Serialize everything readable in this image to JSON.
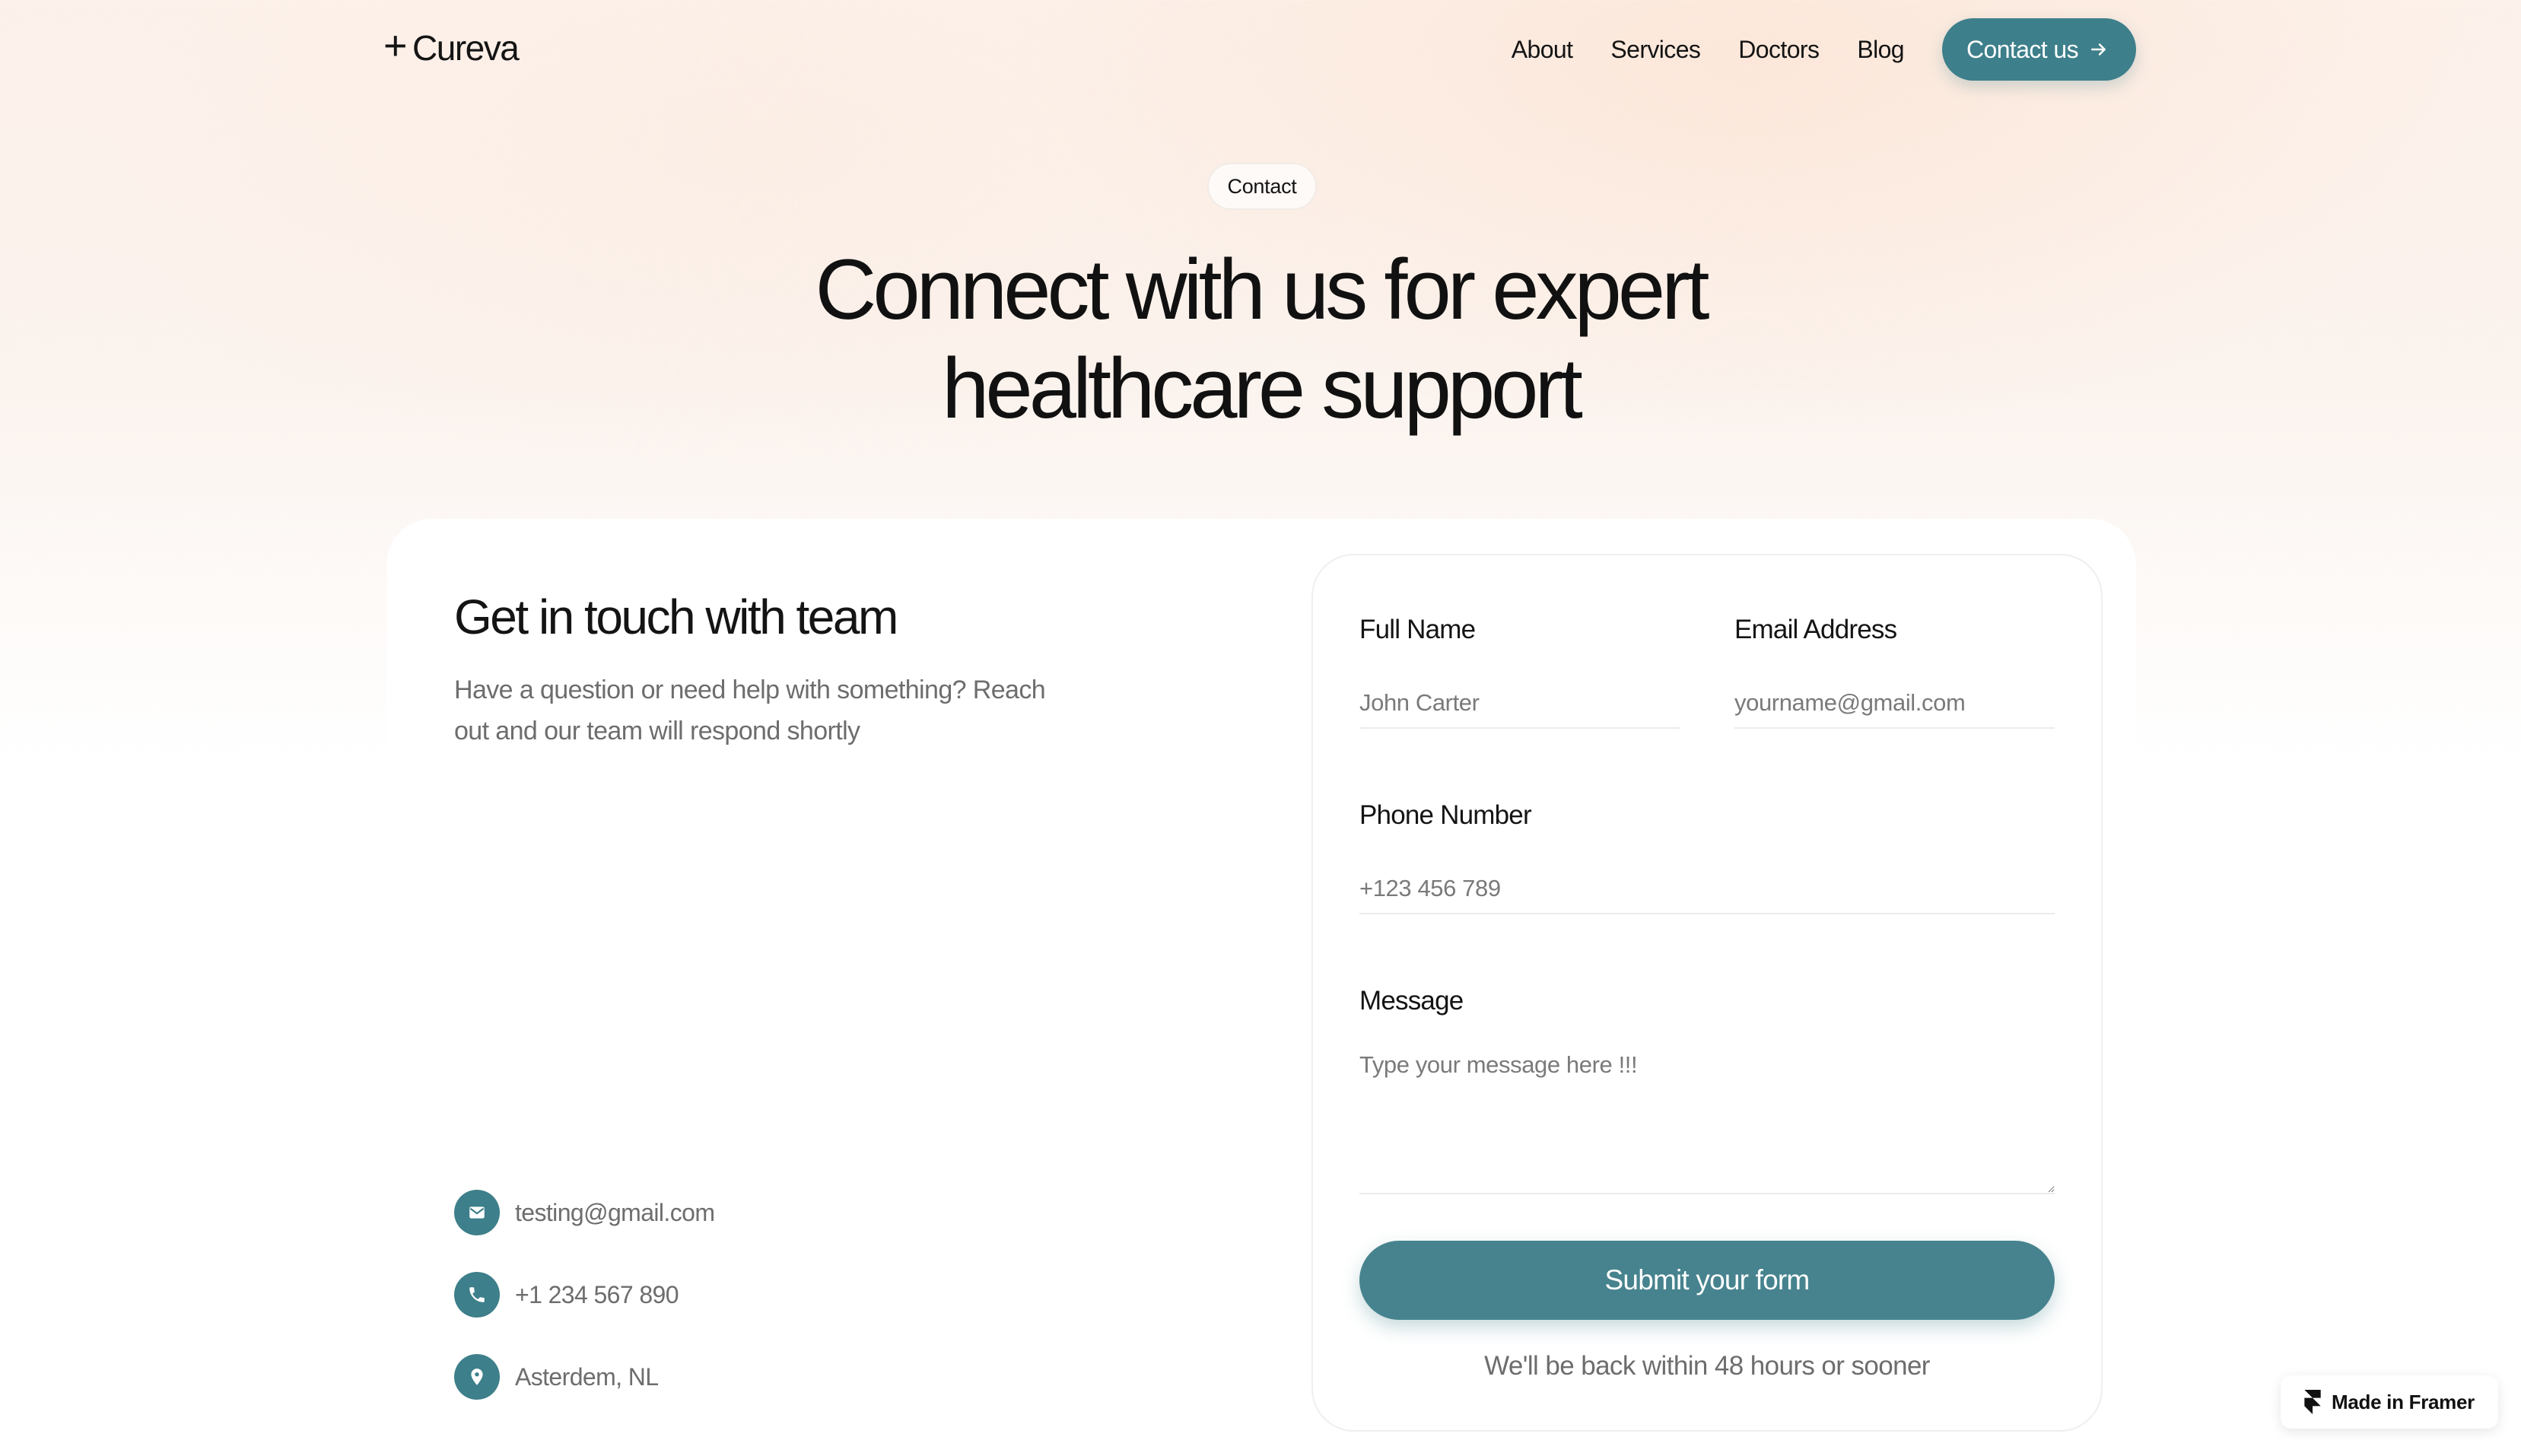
{
  "brand": {
    "logo_symbol": "+",
    "name": "Cureva"
  },
  "nav": {
    "items": [
      "About",
      "Services",
      "Doctors",
      "Blog"
    ],
    "cta_label": "Contact us",
    "cta_icon": "arrow-right-icon"
  },
  "hero": {
    "badge": "Contact",
    "title_line1": "Connect with us for expert",
    "title_line2": "healthcare support"
  },
  "info": {
    "title": "Get in touch with team",
    "description": "Have a question or need help with something? Reach out and our team will respond shortly",
    "contacts": [
      {
        "icon": "mail-icon",
        "text": "testing@gmail.com"
      },
      {
        "icon": "phone-icon",
        "text": "+1 234 567 890"
      },
      {
        "icon": "location-pin-icon",
        "text": "Asterdem, NL"
      }
    ]
  },
  "form": {
    "full_name": {
      "label": "Full Name",
      "placeholder": "John Carter",
      "value": ""
    },
    "email": {
      "label": "Email Address",
      "placeholder": "yourname@gmail.com",
      "value": ""
    },
    "phone": {
      "label": "Phone Number",
      "placeholder": "+123 456 789",
      "value": ""
    },
    "message": {
      "label": "Message",
      "placeholder": "Type your message here !!!",
      "value": ""
    },
    "submit_label": "Submit your form",
    "note": "We'll be back within 48 hours or sooner"
  },
  "framer_badge": {
    "label": "Made in Framer",
    "icon": "framer-logo-icon"
  },
  "colors": {
    "accent": "#3d7f8a",
    "submit": "#46838e",
    "text": "#141414",
    "muted": "#6d6d6d"
  }
}
